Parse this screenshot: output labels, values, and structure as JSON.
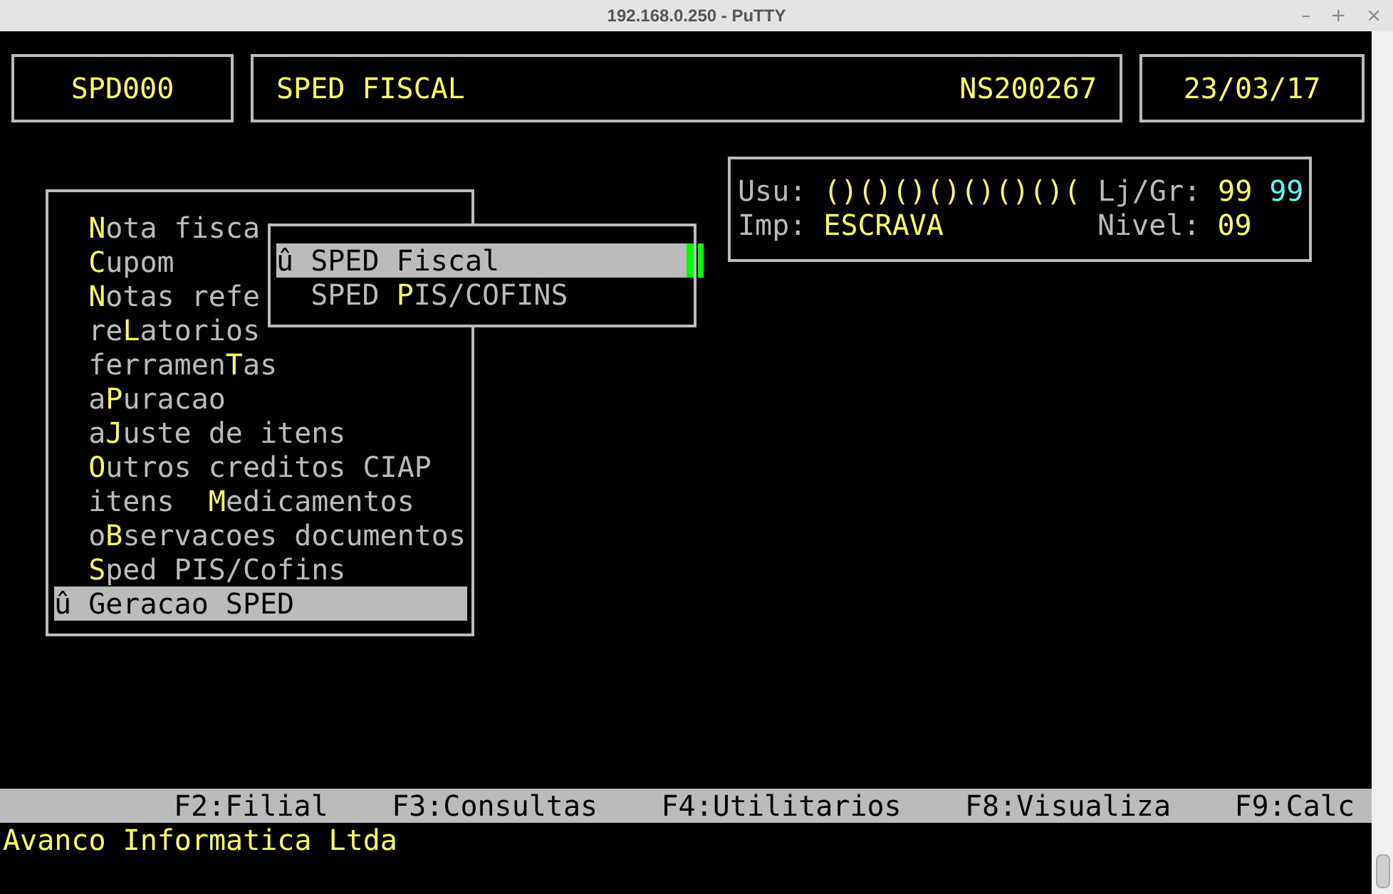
{
  "window": {
    "title": "192.168.0.250 - PuTTY",
    "controls": [
      "–",
      "+",
      "×"
    ]
  },
  "header": {
    "program": "SPD000",
    "module": "SPED FISCAL",
    "serial": "NS200267",
    "date": "23/03/17"
  },
  "info": {
    "user_label": "Usu:",
    "user_value": "()()()()()()()(",
    "store_label": "Lj/Gr:",
    "store_value": "99",
    "group_value": "99",
    "printer_label": "Imp:",
    "printer_value": "ESCRAVA",
    "level_label": "Nivel:",
    "level_value": "09"
  },
  "main_menu": {
    "items": [
      {
        "key": "N",
        "after": "ota fisca",
        "selected": false
      },
      {
        "key": "C",
        "after": "upom",
        "selected": false
      },
      {
        "key": "N",
        "after": "otas refe",
        "selected": false
      },
      {
        "before": "re",
        "key": "L",
        "after": "atorios",
        "selected": false
      },
      {
        "before": "ferramen",
        "key": "T",
        "after": "as",
        "selected": false
      },
      {
        "before": "a",
        "key": "P",
        "after": "uracao",
        "selected": false
      },
      {
        "before": "a",
        "key": "J",
        "after": "uste de itens",
        "selected": false
      },
      {
        "key": "O",
        "after": "utros creditos CIAP",
        "selected": false
      },
      {
        "before": "itens  ",
        "key": "M",
        "after": "edicamentos",
        "selected": false
      },
      {
        "before": "o",
        "key": "B",
        "after": "servacoes documentos",
        "selected": false
      },
      {
        "key": "S",
        "after": "ped PIS/Cofins",
        "selected": false
      },
      {
        "marker": "û",
        "key": "G",
        "after": "eracao SPED",
        "selected": true
      }
    ]
  },
  "submenu": {
    "items": [
      {
        "marker": "û",
        "key": "S",
        "after": "PED Fiscal",
        "selected": true
      },
      {
        "before": "SPED ",
        "key": "P",
        "after": "IS/COFINS",
        "selected": false
      }
    ]
  },
  "status_bar": [
    "F2:Filial",
    "F3:Consultas",
    "F4:Utilitarios",
    "F8:Visualiza",
    "F9:Calc"
  ],
  "footer": "Avanco Informatica Ltda"
}
